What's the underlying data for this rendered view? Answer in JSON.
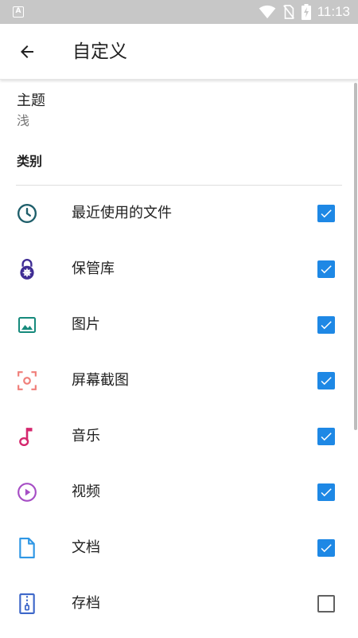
{
  "status_bar": {
    "time": "11:13",
    "left_icon": "a-notification-icon",
    "icons": [
      "wifi-icon",
      "no-sim-icon",
      "battery-charging-icon"
    ],
    "background": "#c7c7c7"
  },
  "app_bar": {
    "back_icon": "arrow-back-icon",
    "title": "自定义"
  },
  "theme": {
    "label": "主题",
    "value": "浅"
  },
  "categories": {
    "header": "类别",
    "accent": "#1e88e5",
    "items": [
      {
        "label": "最近使用的文件",
        "icon": "clock-icon",
        "icon_color": "#1f5f6b",
        "checked": true
      },
      {
        "label": "保管库",
        "icon": "lock-icon",
        "icon_color": "#3f2d94",
        "checked": true
      },
      {
        "label": "图片",
        "icon": "image-icon",
        "icon_color": "#168a7c",
        "checked": true
      },
      {
        "label": "屏幕截图",
        "icon": "screenshot-icon",
        "icon_color": "#f07f7a",
        "checked": true
      },
      {
        "label": "音乐",
        "icon": "music-note-icon",
        "icon_color": "#d5276e",
        "checked": true
      },
      {
        "label": "视频",
        "icon": "play-circle-icon",
        "icon_color": "#a64ec5",
        "checked": true
      },
      {
        "label": "文档",
        "icon": "document-icon",
        "icon_color": "#2f97e5",
        "checked": true
      },
      {
        "label": "存档",
        "icon": "archive-icon",
        "icon_color": "#3d67c9",
        "checked": false
      }
    ]
  }
}
